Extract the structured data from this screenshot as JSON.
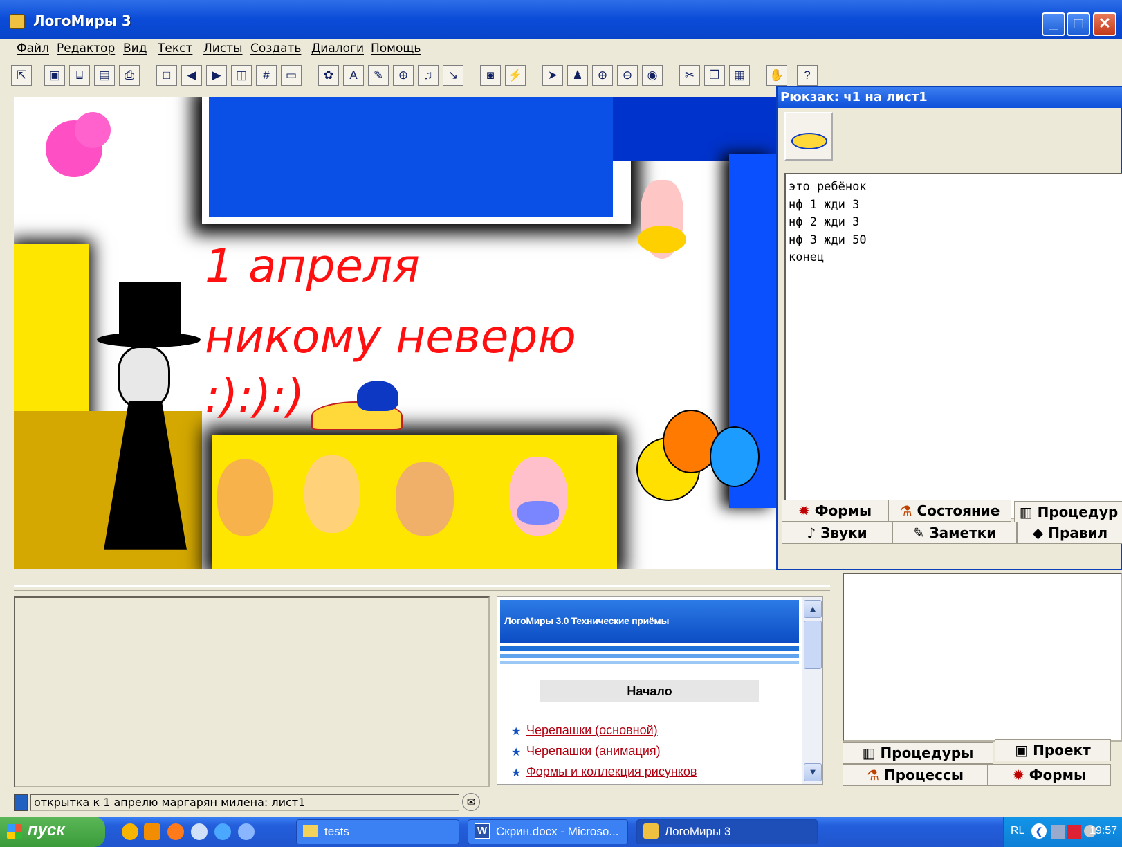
{
  "window": {
    "title": "ЛогоМиры 3"
  },
  "menu": [
    "Файл",
    "Редактор",
    "Вид",
    "Текст",
    "Листы",
    "Создать",
    "Диалоги",
    "Помощь"
  ],
  "toolbar_icons": [
    "pointer-icon",
    "project-icon",
    "open-icon",
    "save-icon",
    "print-icon",
    "new-page-icon",
    "prev-page-icon",
    "next-page-icon",
    "split-icon",
    "grid-icon",
    "frame-icon",
    "turtle-icon",
    "text-icon",
    "paint-icon",
    "button-icon",
    "music-icon",
    "slider-icon",
    "backpack-icon",
    "run-icon",
    "select-icon",
    "stamp-icon",
    "zoom-in-icon",
    "zoom-out-icon",
    "eye-icon",
    "scissors-icon",
    "copy-icon",
    "paste-icon",
    "stop-icon",
    "help-icon"
  ],
  "canvas": {
    "line1": "1 апреля",
    "line2": "никому неверю",
    "line3": ":):):)"
  },
  "backpack": {
    "title": "Рюкзак: ч1 на лист1",
    "code": "это ребёнок\nнф 1 жди 3\nнф 2 жди 3\nнф 3 жди 50\nконец",
    "tabs_row1": [
      "Формы",
      "Состояние",
      "Процедур"
    ],
    "tabs_row2": [
      "Звуки",
      "Заметки",
      "Правил"
    ]
  },
  "help": {
    "header": "ЛогоМиры 3.0 Технические приёмы",
    "start_label": "Начало",
    "links": [
      "Черепашки (основной)",
      "Черепашки (анимация)",
      "Формы и коллекция рисунков"
    ]
  },
  "project_tabs": {
    "row1": [
      "Процедуры",
      "Проект"
    ],
    "row2": [
      "Процессы",
      "Формы"
    ]
  },
  "status": {
    "text": "открытка к 1 апрелю маргарян милена:  лист1"
  },
  "taskbar": {
    "start": "пуск",
    "tasks": [
      "tests",
      "Скрин.docx - Microso...",
      "ЛогоМиры 3"
    ],
    "lang": "RL",
    "clock": "19:57"
  },
  "colors": {
    "canvas_blue": "#0a4fe6",
    "canvas_yellow": "#ffe600",
    "headline_red": "#ff1010",
    "xp_blue": "#0a4bd8"
  }
}
